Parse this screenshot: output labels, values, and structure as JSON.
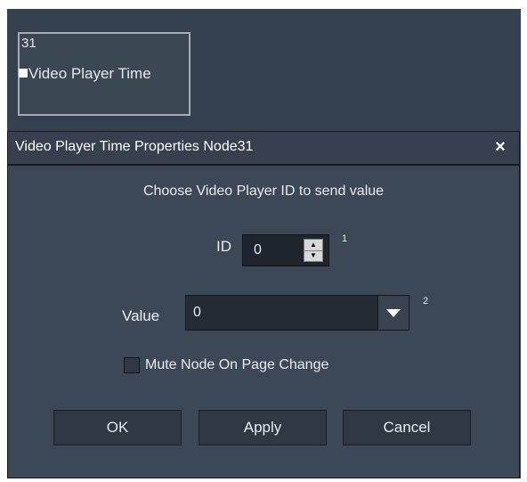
{
  "node": {
    "id": "31",
    "title": "Video Player Time"
  },
  "dialog": {
    "title": "Video Player Time Properties Node31",
    "close_glyph": "×",
    "prompt": "Choose Video Player ID to send value",
    "id_label": "ID",
    "id_value": "0",
    "id_superscript": "1",
    "value_label": "Value",
    "value_selected": "0",
    "value_superscript": "2",
    "mute_label": "Mute Node On Page Change",
    "mute_checked": false,
    "buttons": {
      "ok": "OK",
      "apply": "Apply",
      "cancel": "Cancel"
    }
  },
  "colors": {
    "workspace_bg": "#36414f",
    "dialog_bg": "#3d4856",
    "field_bg": "#1f252e",
    "button_bg": "#2f3946",
    "text": "#e8ecf1"
  },
  "icons": {
    "close": "close-icon",
    "spin_up": "spin-up-arrow-icon",
    "spin_down": "spin-down-arrow-icon",
    "dropdown": "chevron-down-icon"
  }
}
